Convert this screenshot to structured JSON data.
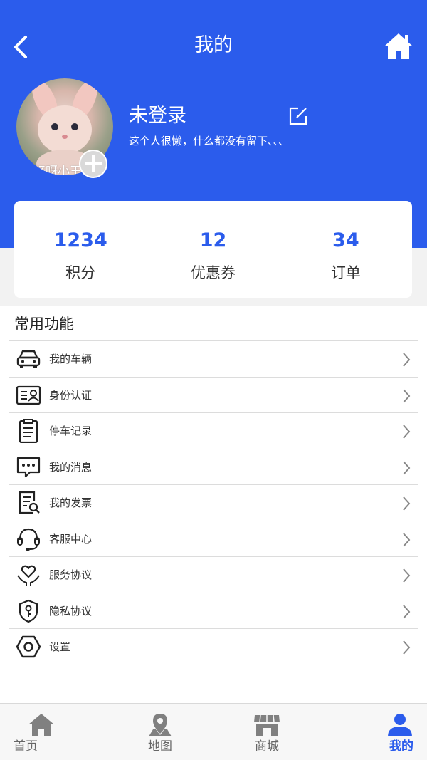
{
  "header": {
    "title": "我的",
    "back_icon": "chevron-left-icon",
    "home_icon": "home-icon",
    "background_color": "#2b5cec"
  },
  "profile": {
    "avatar_caption": "好呀小王",
    "name": "未登录",
    "bio": "这个人很懒，什么都没有留下、、、",
    "edit_icon": "edit-icon",
    "add_icon": "plus-icon"
  },
  "stats": [
    {
      "value": "1234",
      "label": "积分"
    },
    {
      "value": "12",
      "label": "优惠券"
    },
    {
      "value": "34",
      "label": "订单"
    }
  ],
  "functions": {
    "title": "常用功能",
    "items": [
      {
        "label": "我的车辆",
        "icon": "car-icon"
      },
      {
        "label": "身份认证",
        "icon": "id-card-icon"
      },
      {
        "label": "停车记录",
        "icon": "clipboard-icon"
      },
      {
        "label": "我的消息",
        "icon": "message-icon"
      },
      {
        "label": "我的发票",
        "icon": "invoice-search-icon"
      },
      {
        "label": "客服中心",
        "icon": "headset-icon"
      },
      {
        "label": "服务协议",
        "icon": "heart-hand-icon"
      },
      {
        "label": "隐私协议",
        "icon": "shield-key-icon"
      },
      {
        "label": "设置",
        "icon": "hexagon-settings-icon"
      }
    ]
  },
  "tabbar": {
    "active_color": "#2b5cec",
    "items": [
      {
        "label": "首页",
        "icon": "home-icon",
        "active": false
      },
      {
        "label": "地图",
        "icon": "map-pin-icon",
        "active": false
      },
      {
        "label": "商城",
        "icon": "store-icon",
        "active": false
      },
      {
        "label": "我的",
        "icon": "user-icon",
        "active": true
      }
    ]
  }
}
